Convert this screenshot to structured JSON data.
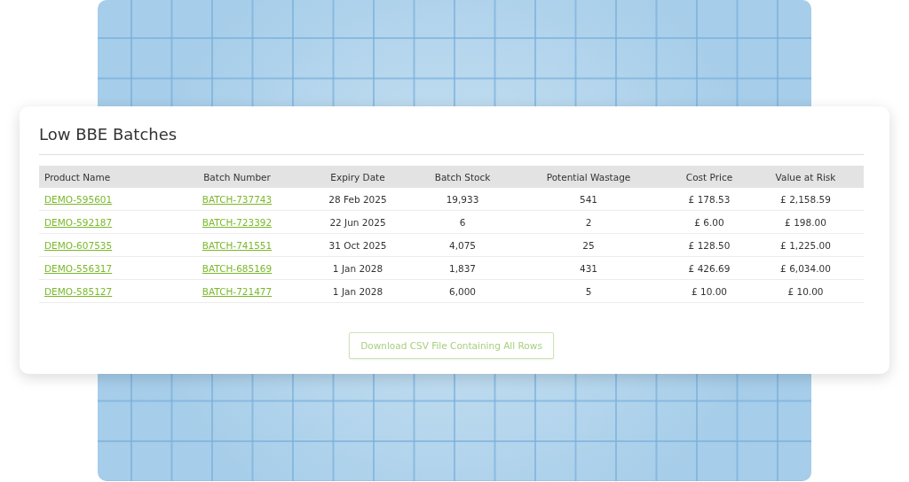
{
  "card": {
    "title": "Low BBE Batches"
  },
  "table": {
    "columns": [
      "Product Name",
      "Batch Number",
      "Expiry Date",
      "Batch Stock",
      "Potential Wastage",
      "Cost Price",
      "Value at Risk"
    ],
    "rows": [
      [
        "DEMO-595601",
        "BATCH-737743",
        "28 Feb 2025",
        "19,933",
        "541",
        "£ 178.53",
        "£ 2,158.59"
      ],
      [
        "DEMO-592187",
        "BATCH-723392",
        "22 Jun 2025",
        "6",
        "2",
        "£ 6.00",
        "£ 198.00"
      ],
      [
        "DEMO-607535",
        "BATCH-741551",
        "31 Oct 2025",
        "4,075",
        "25",
        "£ 128.50",
        "£ 1,225.00"
      ],
      [
        "DEMO-556317",
        "BATCH-685169",
        "1 Jan 2028",
        "1,837",
        "431",
        "£ 426.69",
        "£ 6,034.00"
      ],
      [
        "DEMO-585127",
        "BATCH-721477",
        "1 Jan 2028",
        "6,000",
        "5",
        "£ 10.00",
        "£ 10.00"
      ]
    ]
  },
  "download_button": {
    "label": "Download CSV File Containing All Rows"
  }
}
